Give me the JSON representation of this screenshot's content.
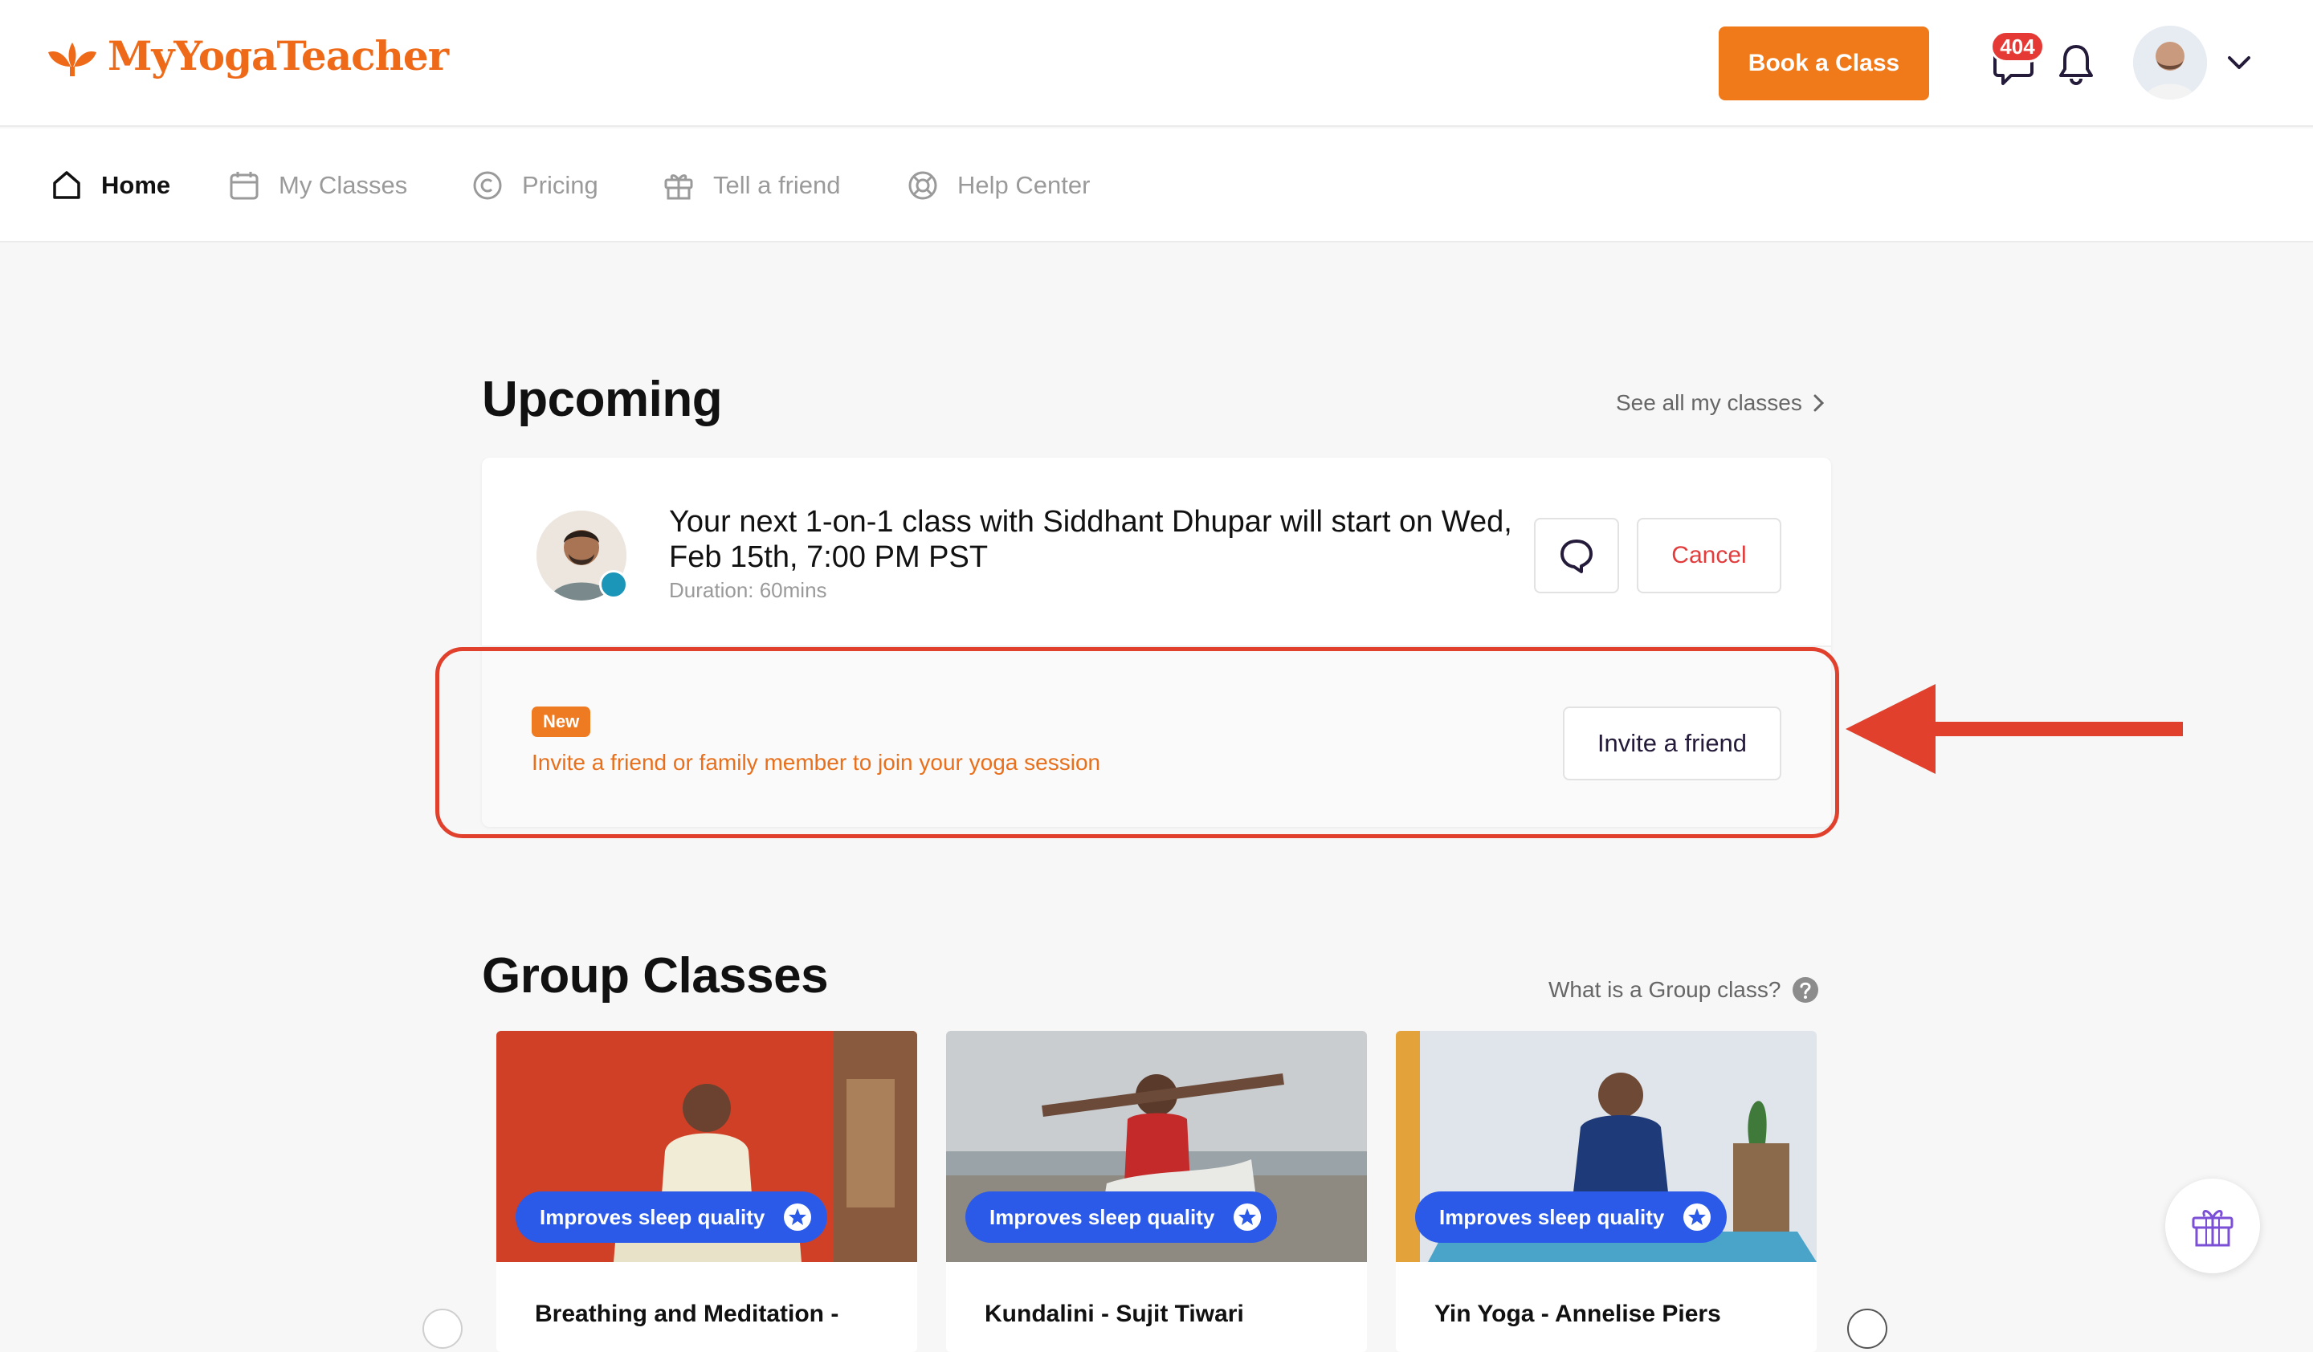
{
  "brand": {
    "name": "MyYogaTeacher",
    "accent": "#f07a1a"
  },
  "header": {
    "book_button": "Book a Class",
    "message_count": "404",
    "icons": [
      "message-icon",
      "bell-icon",
      "avatar",
      "chevron-down-icon"
    ]
  },
  "nav": {
    "items": [
      {
        "label": "Home",
        "icon": "home-icon",
        "active": true
      },
      {
        "label": "My Classes",
        "icon": "calendar-icon"
      },
      {
        "label": "Pricing",
        "icon": "copyright-icon"
      },
      {
        "label": "Tell a friend",
        "icon": "gift-icon"
      },
      {
        "label": "Help Center",
        "icon": "lifebuoy-icon"
      }
    ]
  },
  "upcoming": {
    "title": "Upcoming",
    "see_all": "See all my classes",
    "class_text": "Your next 1-on-1 class with Siddhant Dhupar will start on Wed, Feb 15th, 7:00 PM PST",
    "duration": "Duration: 60mins",
    "cancel_button": "Cancel",
    "new_badge": "New",
    "invite_text": "Invite a friend or family member to join your yoga session",
    "invite_button": "Invite a friend"
  },
  "group": {
    "title": "Group Classes",
    "help_link": "What is a Group class?",
    "cards": [
      {
        "tag": "Improves sleep quality",
        "title": "Breathing and Meditation -"
      },
      {
        "tag": "Improves sleep quality",
        "title": "Kundalini - Sujit Tiwari"
      },
      {
        "tag": "Improves sleep quality",
        "title": "Yin Yoga - Annelise Piers"
      }
    ]
  }
}
